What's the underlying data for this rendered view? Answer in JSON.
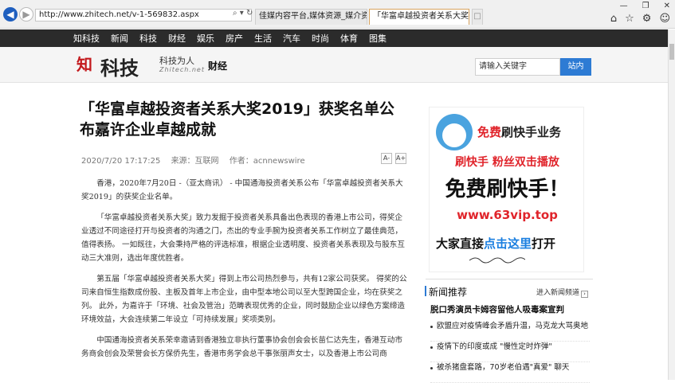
{
  "browser": {
    "address": "http://www.zhitech.net/v-1-569832.aspx",
    "tabs": [
      "佳媒内容平台,媒体资源_媒介资...",
      "「华富卓越投资者关系大奖2..."
    ],
    "window_controls": [
      "—",
      "❐",
      "✕"
    ]
  },
  "site_nav": [
    "知科技",
    "新闻",
    "科技",
    "财经",
    "娱乐",
    "房产",
    "生活",
    "汽车",
    "时尚",
    "体育",
    "图集"
  ],
  "header": {
    "logo_mark": "知",
    "logo_text": "科技",
    "slogan": "科技为人",
    "slogan_domain": "Zhitech.net",
    "channel": "财经",
    "search_placeholder": "请输入关键字",
    "search_button": "站内"
  },
  "article": {
    "title": "「华富卓越投资者关系大奖2019」获奖名单公布嘉许企业卓越成就",
    "date": "2020/7/20 17:17:25",
    "source": "来源：互联网",
    "author": "作者：acnnewswire",
    "font_smaller": "A-",
    "font_larger": "A+",
    "paragraphs": [
      "香港，2020年7月20日 -（亚太商讯） - 中国通海投资者关系公布「华富卓越投资者关系大奖2019」的获奖企业名单。",
      "「华富卓越投资者关系大奖」致力发掘于投资者关系具备出色表现的香港上市公司，得奖企业透过不同途径打开与投资者的沟通之门，杰出的专业手腕为投资者关系工作树立了最佳典范，值得表扬。 一如既往，大会秉持严格的评选标准，根据企业透明度、投资者关系表现及与股东互动三大准则，选出年度优胜者。",
      "第五届「华富卓越投资者关系大奖」得到上市公司热烈参与，共有12家公司获奖。 得奖的公司来自恒生指数成份股、主板及首年上市企业，由中型本地公司以至大型跨国企业，均在获奖之列。 此外，为嘉许于「环境、社会及管治」范畴表现优秀的企业，同时鼓励企业以绿色方案缔造环境效益，大会连续第二年设立「可持续发展」奖项类别。",
      "中国通海投资者关系荣幸邀请到香港独立非执行董事协会创会会长苗仁达先生，香港互动市务商会创会及荣誉会长方保侨先生，香港市务学会总干事张丽声女士，以及香港上市公司商"
    ]
  },
  "ad": {
    "line1_red": "免费",
    "line1_rest": "刷快手业务",
    "line2": "刷快手 粉丝双击播放",
    "line3": "免费刷快手！",
    "line4": "www.63vip.top",
    "line5_a": "大家直接",
    "line5_link": "点击这里",
    "line5_b": "打开"
  },
  "news": {
    "heading": "新闻推荐",
    "more": "进入新闻频道",
    "featured": "脱口秀演员卡姆容留他人吸毒案宣判",
    "items": [
      "欧盟应对疫情峰会矛盾升温，马克龙大骂奥地",
      "疫情下的印度或成 \"慢性定时炸弹\"",
      "被杀猪盘套路，70岁老伯遇\"真爱\" 聊天"
    ]
  }
}
